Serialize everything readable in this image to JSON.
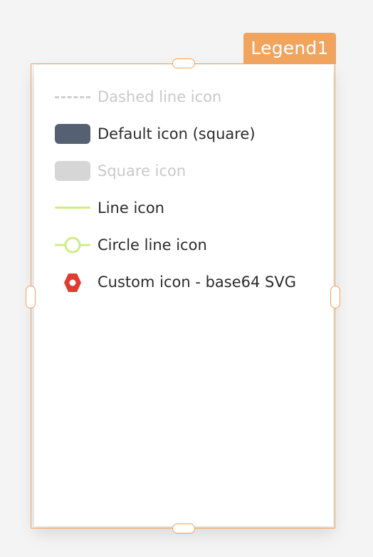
{
  "component": {
    "name_tag": "Legend1"
  },
  "legend": {
    "items": [
      {
        "label": "Dashed line icon",
        "icon": "dashed-line",
        "state": "disabled"
      },
      {
        "label": "Default icon (square)",
        "icon": "square",
        "state": "enabled",
        "color": "#566073"
      },
      {
        "label": "Square icon",
        "icon": "square",
        "state": "disabled",
        "color": "#d6d6d6"
      },
      {
        "label": "Line icon",
        "icon": "line",
        "state": "enabled",
        "color": "#cdec88"
      },
      {
        "label": "Circle line icon",
        "icon": "circle-line",
        "state": "enabled",
        "color": "#cdec88"
      },
      {
        "label": "Custom icon - base64 SVG",
        "icon": "hex-nut",
        "state": "enabled",
        "color": "#e23b2f"
      }
    ]
  },
  "theme": {
    "selection_color": "#f0a45e"
  }
}
